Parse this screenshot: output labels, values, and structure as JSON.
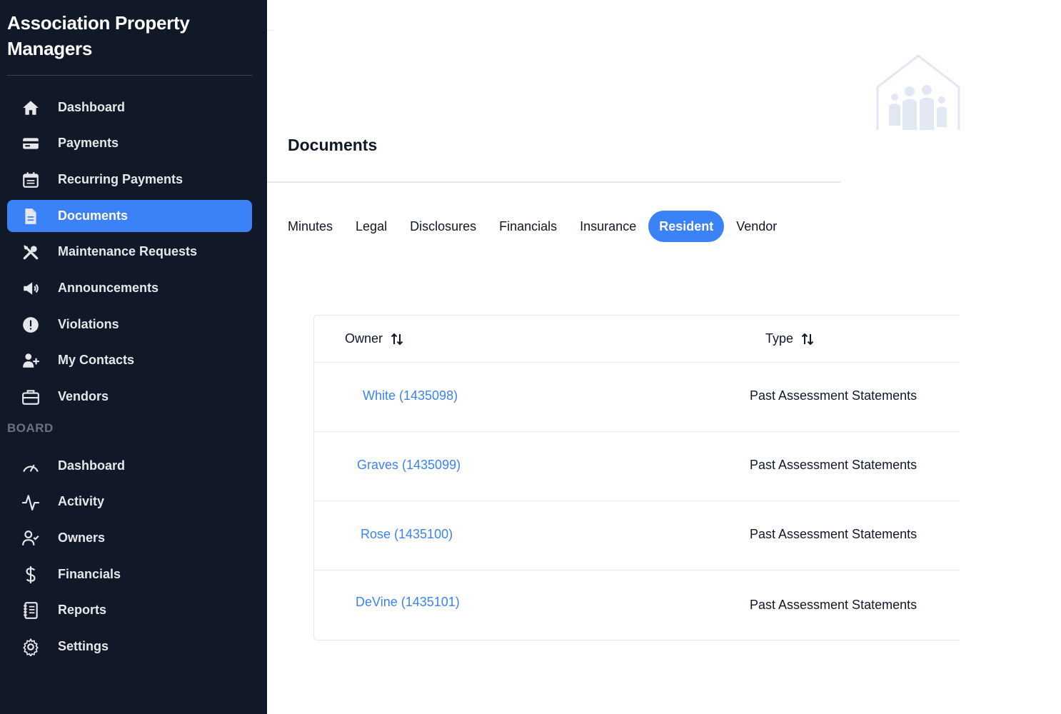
{
  "sidebar": {
    "brand": "Association Property Managers",
    "items": [
      {
        "label": "Dashboard",
        "icon": "home-icon"
      },
      {
        "label": "Payments",
        "icon": "credit-card-icon"
      },
      {
        "label": "Recurring Payments",
        "icon": "calendar-icon"
      },
      {
        "label": "Documents",
        "icon": "document-icon",
        "active": true
      },
      {
        "label": "Maintenance Requests",
        "icon": "tools-icon"
      },
      {
        "label": "Announcements",
        "icon": "megaphone-icon"
      },
      {
        "label": "Violations",
        "icon": "alert-icon"
      },
      {
        "label": "My Contacts",
        "icon": "user-plus-icon"
      },
      {
        "label": "Vendors",
        "icon": "briefcase-icon"
      }
    ],
    "board_label": "BOARD",
    "board_items": [
      {
        "label": "Dashboard",
        "icon": "gauge-icon"
      },
      {
        "label": "Activity",
        "icon": "activity-icon"
      },
      {
        "label": "Owners",
        "icon": "user-check-icon"
      },
      {
        "label": "Financials",
        "icon": "dollar-icon"
      },
      {
        "label": "Reports",
        "icon": "notebook-icon"
      },
      {
        "label": "Settings",
        "icon": "gear-icon"
      }
    ]
  },
  "main": {
    "title": "Documents",
    "tabs": [
      {
        "label": "Minutes"
      },
      {
        "label": "Legal"
      },
      {
        "label": "Disclosures"
      },
      {
        "label": "Financials"
      },
      {
        "label": "Insurance"
      },
      {
        "label": "Resident",
        "active": true
      },
      {
        "label": "Vendor"
      }
    ],
    "table": {
      "columns": [
        "Owner",
        "Type"
      ],
      "rows": [
        {
          "owner": "White (1435098)",
          "type": "Past Assessment Statements"
        },
        {
          "owner": "Graves (1435099)",
          "type": "Past Assessment Statements"
        },
        {
          "owner": "Rose (1435100)",
          "type": "Past Assessment Statements"
        },
        {
          "owner": "DeVine (1435101)",
          "type": "Past Assessment Statements"
        }
      ]
    }
  },
  "colors": {
    "sidebar_bg": "#111827",
    "accent": "#3b82f6",
    "link": "#3b82f6"
  },
  "logo_icon": "house-family-icon"
}
